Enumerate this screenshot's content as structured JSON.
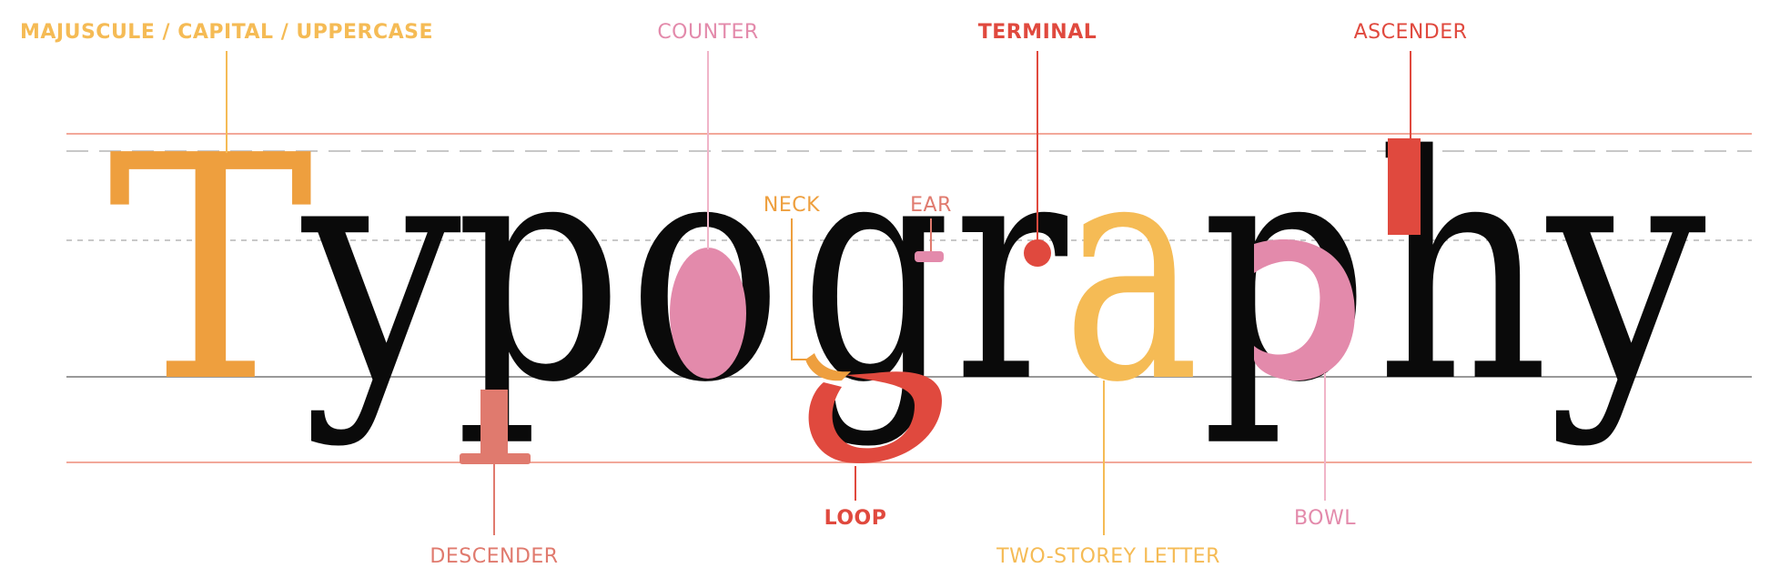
{
  "word": "Typography",
  "letters": [
    "T",
    "y",
    "p",
    "o",
    "g",
    "r",
    "a",
    "p",
    "h",
    "y"
  ],
  "labels": {
    "majuscule": "MAJUSCULE / CAPITAL / UPPERCASE",
    "counter": "COUNTER",
    "terminal": "TERMINAL",
    "ascender": "ASCENDER",
    "neck": "NECK",
    "ear": "EAR",
    "descender": "DESCENDER",
    "loop": "LOOP",
    "two_storey": "TWO-STOREY LETTER",
    "bowl": "BOWL"
  },
  "colors": {
    "orange": "#EE9F3E",
    "light_orange": "#F5BB55",
    "pink": "#E38AAB",
    "red": "#E0493E",
    "salmon": "#E07A6E",
    "black": "#0a0a0a",
    "guide_red": "#F2A89A",
    "guide_gray": "#BBBBBB",
    "baseline_gray": "#999999"
  }
}
